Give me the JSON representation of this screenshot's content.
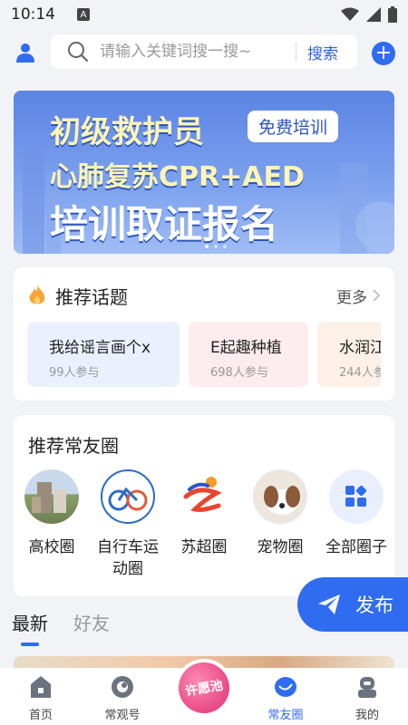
{
  "status_bar": {
    "time": "10:14",
    "a_badge": "A"
  },
  "search": {
    "placeholder": "请输入关键词搜一搜~",
    "button_label": "搜索"
  },
  "banner": {
    "line1": "初级救护员",
    "tag": "免费培训",
    "line2": "心肺复苏CPR+AED",
    "line3": "培训取证报名"
  },
  "topics": {
    "title": "推荐话题",
    "more_label": "更多",
    "items": [
      {
        "title": "我给谣言画个x",
        "meta": "99人参与"
      },
      {
        "title": "E起趣种植",
        "meta": "698人参与"
      },
      {
        "title": "水润江",
        "meta": "244人参"
      }
    ]
  },
  "circles": {
    "title": "推荐常友圈",
    "items": [
      {
        "label": "高校圈",
        "icon": "campus-building-icon"
      },
      {
        "label": "自行车运动圈",
        "icon": "bicycle-icon"
      },
      {
        "label": "苏超圈",
        "icon": "su-super-league-icon"
      },
      {
        "label": "宠物圈",
        "icon": "puppy-icon"
      },
      {
        "label": "全部圈子",
        "icon": "grid-apps-icon"
      }
    ]
  },
  "publish_label": "发布",
  "feed_tabs": [
    {
      "label": "最新",
      "active": true
    },
    {
      "label": "好友",
      "active": false
    }
  ],
  "bottom_nav": [
    {
      "label": "首页",
      "icon": "home-icon",
      "active": false
    },
    {
      "label": "常观号",
      "icon": "changguan-icon",
      "active": false
    },
    {
      "label": "常友圈",
      "icon": "circle-bubble-icon",
      "active": true
    },
    {
      "label": "我的",
      "icon": "profile-icon",
      "active": false
    }
  ],
  "wish_label": "许愿池",
  "colors": {
    "accent": "#2f6cf0",
    "background": "#f1f3f7"
  }
}
